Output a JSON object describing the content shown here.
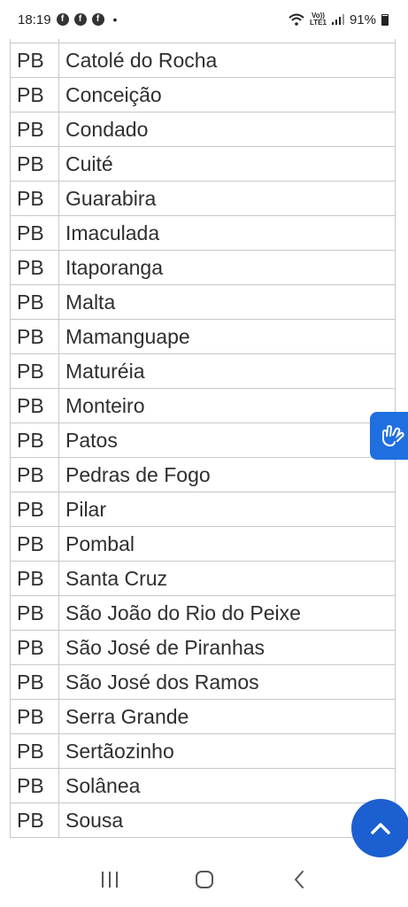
{
  "status_bar": {
    "time": "18:19",
    "notification_icons": [
      "facebook-icon",
      "facebook-icon",
      "facebook-icon"
    ],
    "network_label_top": "Vo))",
    "network_label_bottom": "LTE1",
    "battery_percent": "91%"
  },
  "table": {
    "rows": [
      {
        "uf": "PB",
        "city": "Catolé do Rocha"
      },
      {
        "uf": "PB",
        "city": "Conceição"
      },
      {
        "uf": "PB",
        "city": "Condado"
      },
      {
        "uf": "PB",
        "city": "Cuité"
      },
      {
        "uf": "PB",
        "city": "Guarabira"
      },
      {
        "uf": "PB",
        "city": "Imaculada"
      },
      {
        "uf": "PB",
        "city": "Itaporanga"
      },
      {
        "uf": "PB",
        "city": "Malta"
      },
      {
        "uf": "PB",
        "city": "Mamanguape"
      },
      {
        "uf": "PB",
        "city": "Maturéia"
      },
      {
        "uf": "PB",
        "city": "Monteiro"
      },
      {
        "uf": "PB",
        "city": "Patos"
      },
      {
        "uf": "PB",
        "city": "Pedras de Fogo"
      },
      {
        "uf": "PB",
        "city": "Pilar"
      },
      {
        "uf": "PB",
        "city": "Pombal"
      },
      {
        "uf": "PB",
        "city": "Santa Cruz"
      },
      {
        "uf": "PB",
        "city": "São João do Rio do Peixe"
      },
      {
        "uf": "PB",
        "city": "São José de Piranhas"
      },
      {
        "uf": "PB",
        "city": "São José dos Ramos"
      },
      {
        "uf": "PB",
        "city": "Serra Grande"
      },
      {
        "uf": "PB",
        "city": "Sertãozinho"
      },
      {
        "uf": "PB",
        "city": "Solânea"
      },
      {
        "uf": "PB",
        "city": "Sousa"
      }
    ]
  },
  "widgets": {
    "accessibility_icon": "sign-language-hands-icon",
    "scroll_top_icon": "chevron-up-icon",
    "accent_color": "#1f6fe0"
  },
  "nav_bar": {
    "icons": [
      "recent-apps-icon",
      "home-icon",
      "back-icon"
    ]
  }
}
